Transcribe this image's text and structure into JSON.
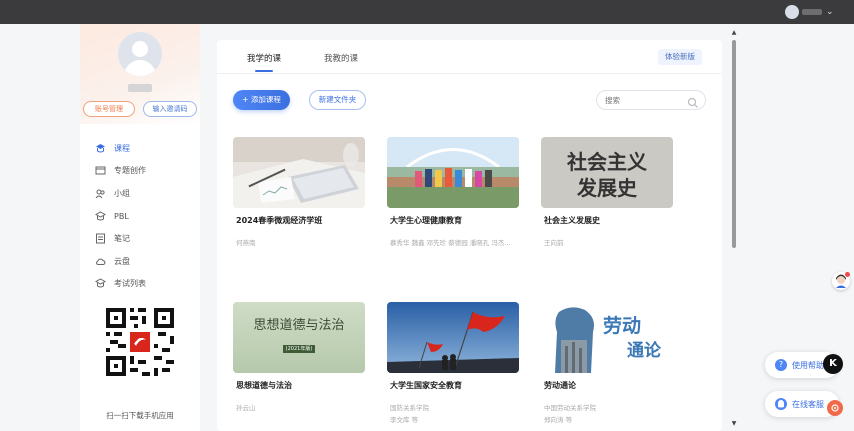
{
  "topbar": {
    "menu_caret": "⌄"
  },
  "sidebar": {
    "account_button": "账号管理",
    "invite_button": "输入邀请码",
    "items": [
      {
        "label": "课程",
        "icon": "course-icon"
      },
      {
        "label": "专题创作",
        "icon": "topic-icon"
      },
      {
        "label": "小组",
        "icon": "group-icon"
      },
      {
        "label": "PBL",
        "icon": "pbl-icon"
      },
      {
        "label": "笔记",
        "icon": "note-icon"
      },
      {
        "label": "云盘",
        "icon": "cloud-icon"
      },
      {
        "label": "考试列表",
        "icon": "exam-icon"
      }
    ],
    "qr_caption": "扫一扫下载手机应用"
  },
  "main": {
    "tabs": [
      {
        "label": "我学的课"
      },
      {
        "label": "我教的课"
      }
    ],
    "new_version_button": "体验新版",
    "add_course_button": "添加课程",
    "new_folder_button": "新建文件夹",
    "search_placeholder": "搜索",
    "courses": [
      {
        "title": "2024春季微观经济学班",
        "teacher": "何燕南",
        "org": ""
      },
      {
        "title": "大学生心理健康教育",
        "teacher": "慕秀华 魏鑫 邓先珍 蔡德园 潘晓孔 冯杰...",
        "org": ""
      },
      {
        "title": "社会主义发展史",
        "teacher": "王向前",
        "org": "",
        "cover_text": [
          "社会主义",
          "发展史"
        ]
      },
      {
        "title": "思想道德与法治",
        "teacher": "孙云山",
        "org": "",
        "cover_text": [
          "思想道德与法治"
        ],
        "cover_badge": "(2021年版)"
      },
      {
        "title": "大学生国家安全教育",
        "teacher": "李文库 等",
        "org": "国防关系学院"
      },
      {
        "title": "劳动通论",
        "teacher": "郑向涛 等",
        "org": "中国劳动关系学院",
        "cover_text": [
          "劳动",
          "通论"
        ]
      }
    ]
  },
  "floating": {
    "help_label": "使用帮助",
    "service_label": "在线客服",
    "k_badge": "K"
  },
  "colors": {
    "accent": "#3a6fe0",
    "account_orange": "#ee7a4a"
  }
}
